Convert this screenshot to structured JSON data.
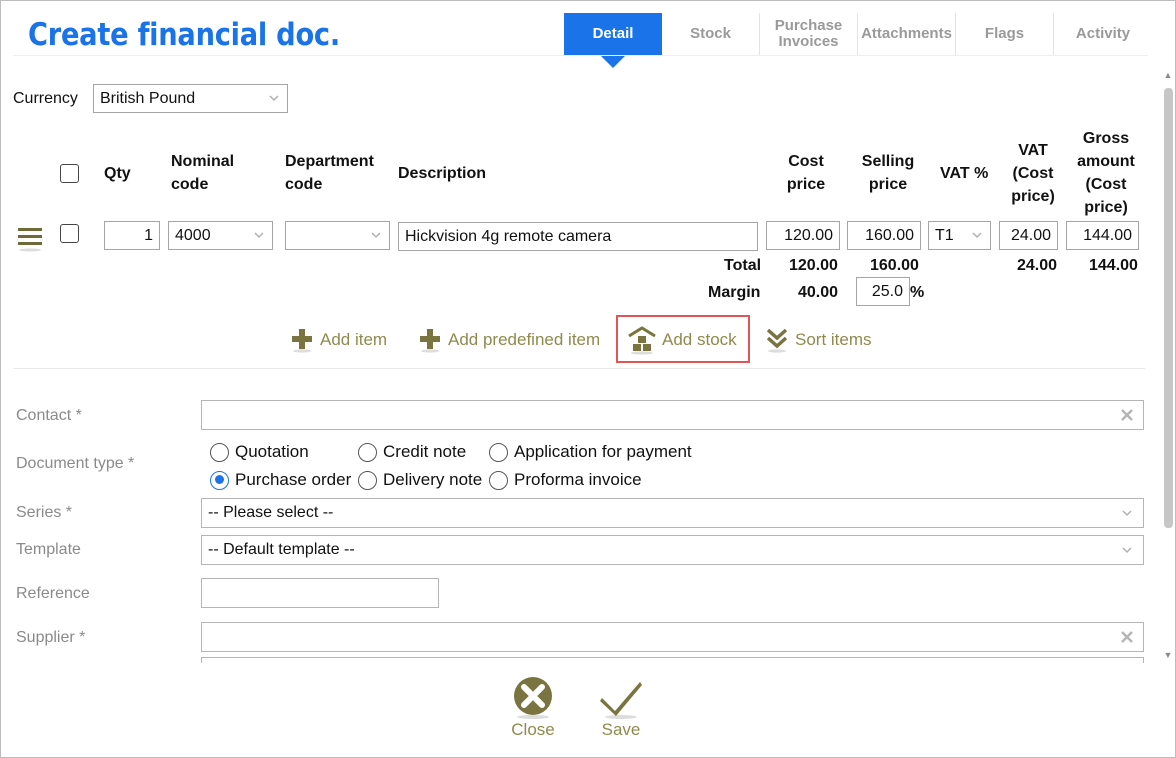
{
  "page": {
    "title": "Create financial doc."
  },
  "tabs": [
    {
      "label": "Detail",
      "active": true
    },
    {
      "label": "Stock"
    },
    {
      "label": "Purchase Invoices"
    },
    {
      "label": "Attachments"
    },
    {
      "label": "Flags"
    },
    {
      "label": "Activity"
    }
  ],
  "currency": {
    "label": "Currency",
    "value": "British Pound"
  },
  "table": {
    "headers": {
      "qty": "Qty",
      "nominal_code": "Nominal code",
      "department_code": "Department code",
      "description": "Description",
      "cost_price": "Cost price",
      "selling_price": "Selling price",
      "vat_pct": "VAT %",
      "vat_cost": "VAT (Cost price)",
      "gross_amount": "Gross amount (Cost price)"
    },
    "rows": [
      {
        "qty": "1",
        "nominal_code": "4000",
        "department_code": "",
        "description": "Hickvision 4g remote camera",
        "cost_price": "120.00",
        "selling_price": "160.00",
        "vat_code": "T1",
        "vat_cost": "24.00",
        "gross_amount": "144.00"
      }
    ],
    "totals": {
      "label": "Total",
      "cost_price": "120.00",
      "selling_price": "160.00",
      "vat_cost": "24.00",
      "gross_amount": "144.00"
    },
    "margin": {
      "label": "Margin",
      "amount": "40.00",
      "percent": "25.0",
      "percent_sign": "%"
    }
  },
  "actions": {
    "add_item": "Add item",
    "add_predefined_item": "Add predefined item",
    "add_stock": "Add stock",
    "sort_items": "Sort items"
  },
  "form": {
    "contact": {
      "label": "Contact *",
      "value": ""
    },
    "document_type": {
      "label": "Document type *",
      "options": [
        "Quotation",
        "Credit note",
        "Application for payment",
        "Purchase order",
        "Delivery note",
        "Proforma invoice"
      ],
      "selected": "Purchase order"
    },
    "series": {
      "label": "Series *",
      "value": "-- Please select --"
    },
    "template": {
      "label": "Template",
      "value": "-- Default template --"
    },
    "reference": {
      "label": "Reference",
      "value": ""
    },
    "supplier": {
      "label": "Supplier *",
      "value": ""
    }
  },
  "footer": {
    "close": "Close",
    "save": "Save"
  },
  "colors": {
    "accent": "#1a73e8",
    "action": "#8f8a4e",
    "highlight": "#e05656"
  }
}
